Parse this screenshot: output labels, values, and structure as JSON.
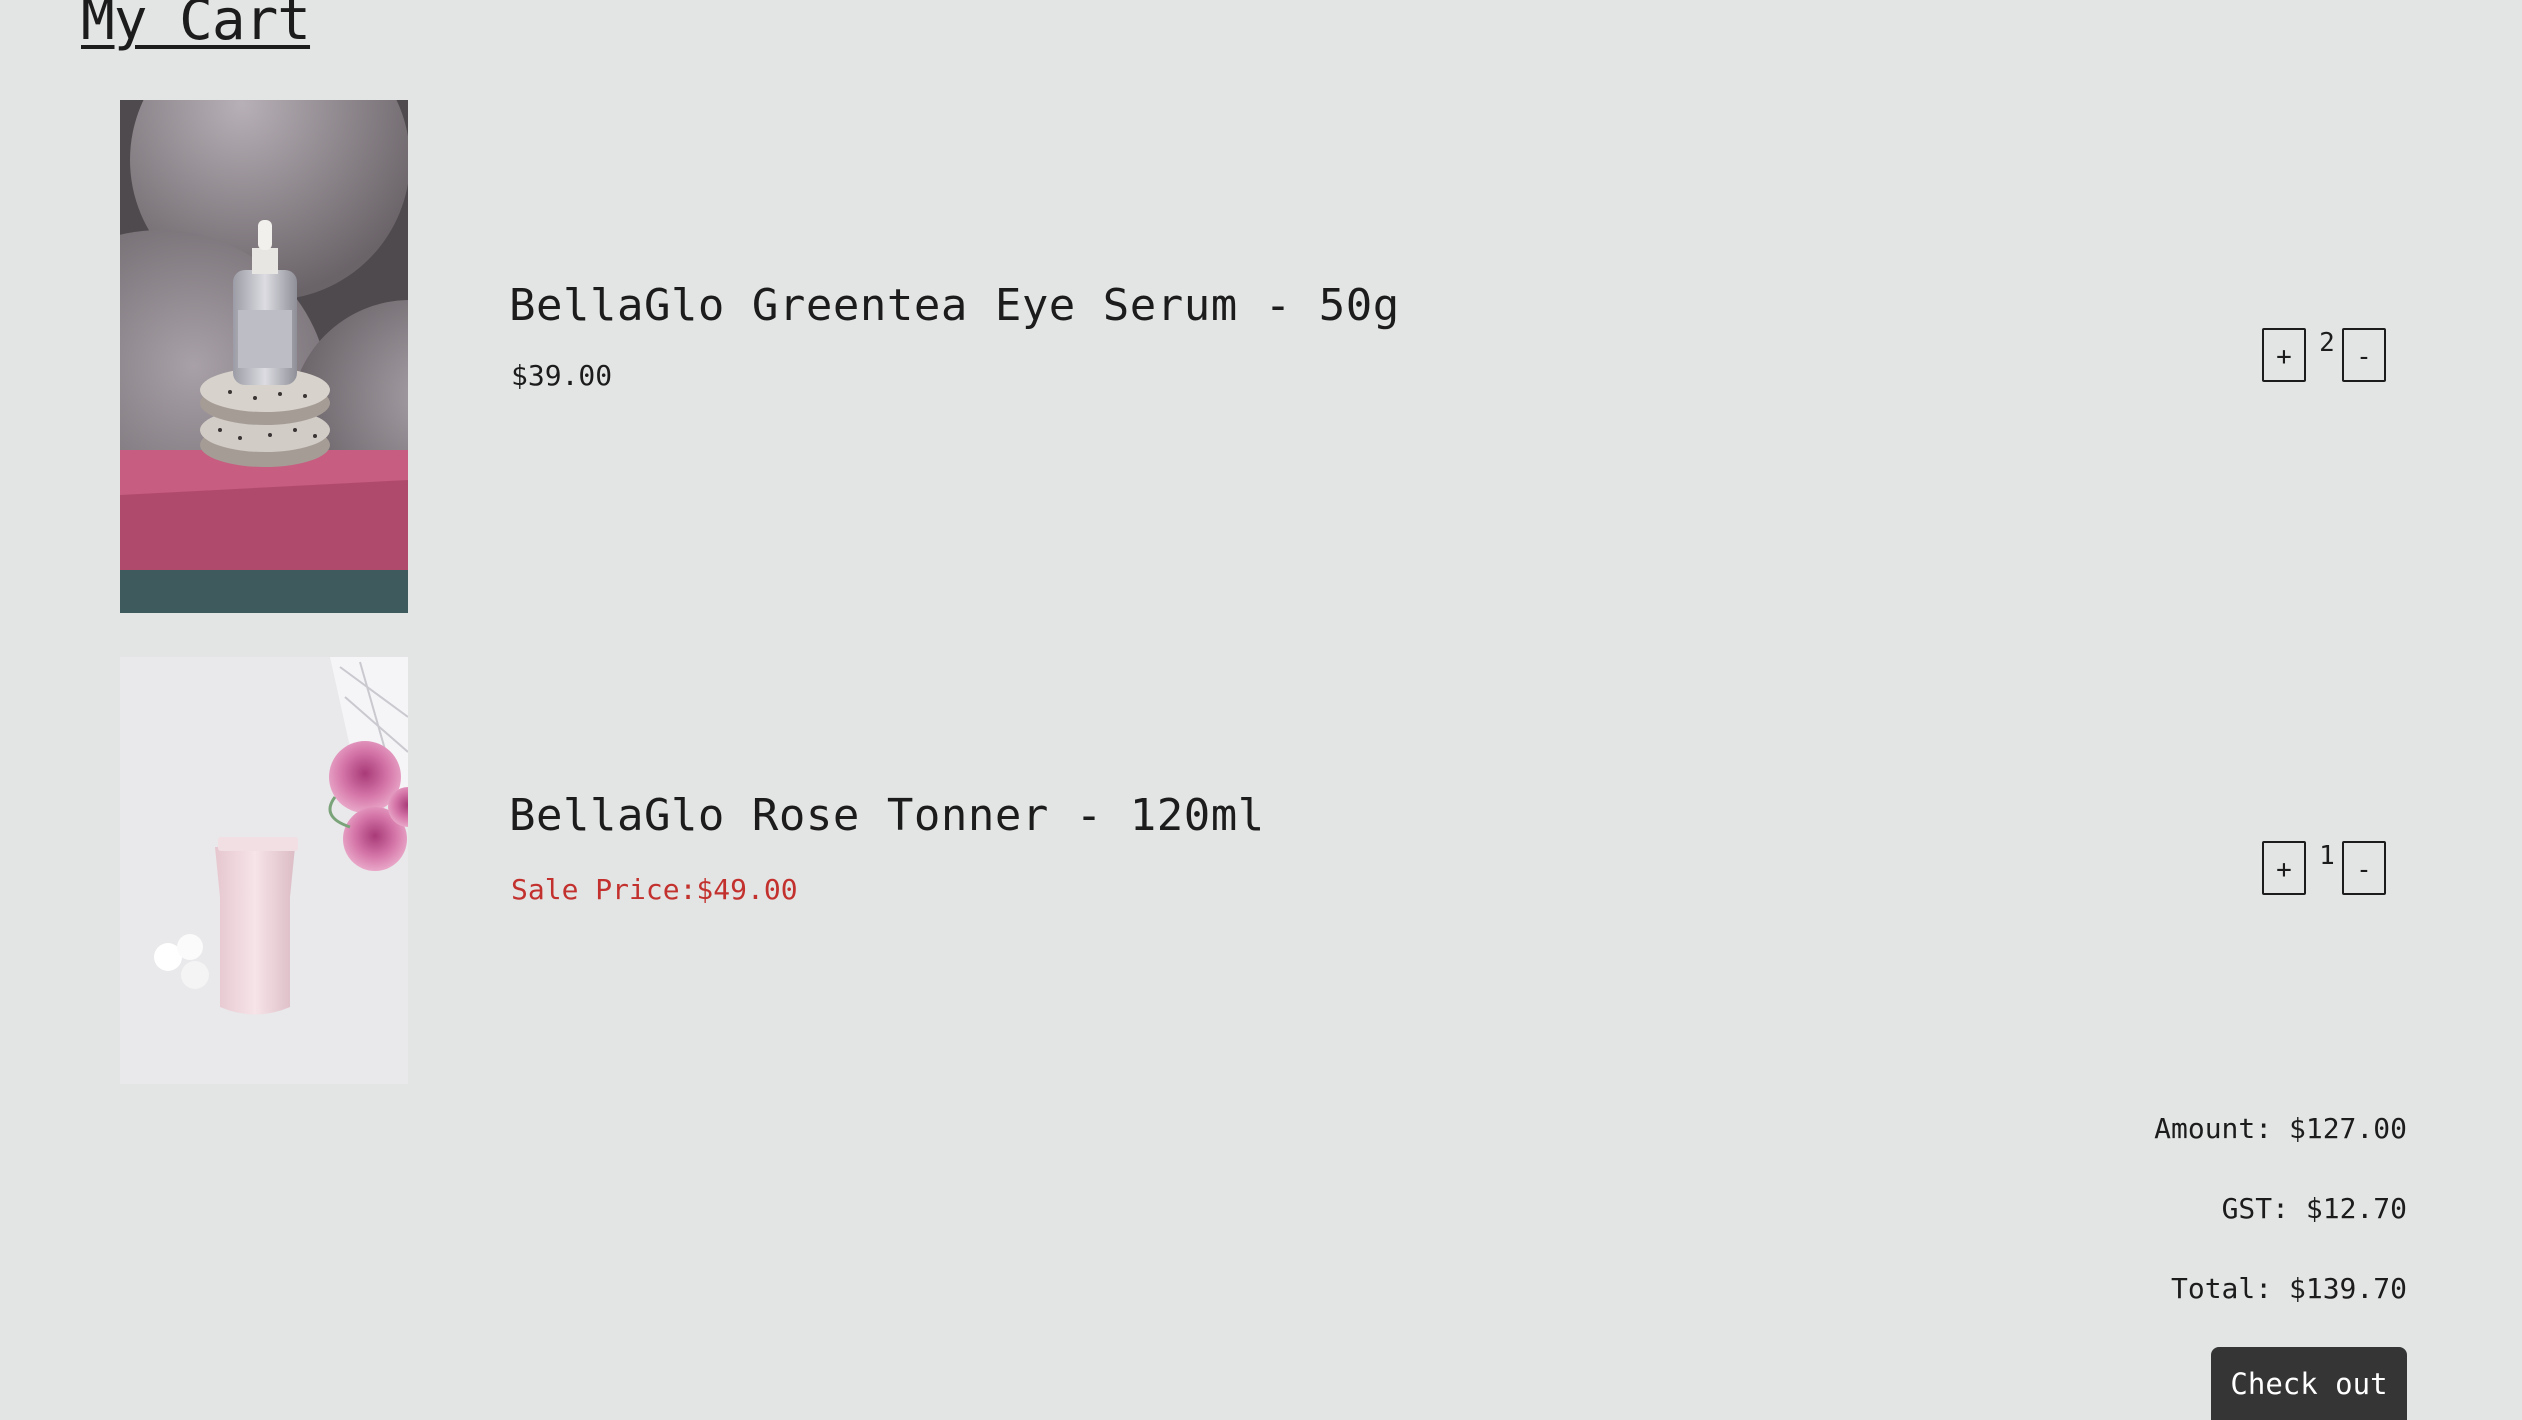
{
  "page": {
    "title": "My Cart"
  },
  "cart": {
    "items": [
      {
        "name": "BellaGlo Greentea Eye Serum - 50g",
        "price": "$39.00",
        "quantity": "2",
        "increment_label": "+",
        "decrement_label": "-"
      },
      {
        "name": "BellaGlo Rose Tonner - 120ml",
        "price": "Sale Price:$49.00",
        "quantity": "1",
        "increment_label": "+",
        "decrement_label": "-"
      }
    ]
  },
  "summary": {
    "amount": "Amount: $127.00",
    "gst": "GST: $12.70",
    "total": "Total: $139.70"
  },
  "checkout": {
    "label": "Check out"
  },
  "colors": {
    "background": "#e3e5e4",
    "sale_price": "#c3312e",
    "checkout_button": "#353535"
  }
}
